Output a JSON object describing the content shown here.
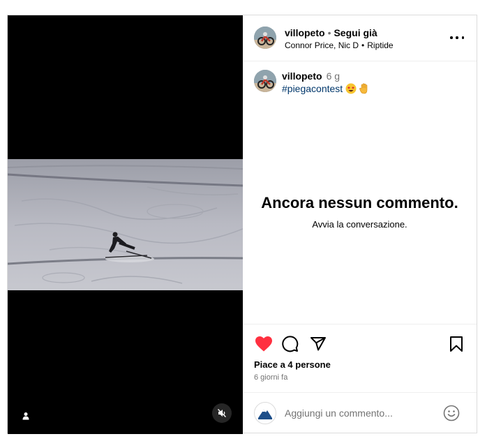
{
  "post": {
    "media": {
      "kind": "video",
      "description": "skier carving on a snowy slope",
      "tag_icon": "person-icon",
      "mute_icon": "muted-speaker-icon"
    },
    "header": {
      "username": "villopeto",
      "separator": "•",
      "follow_label": "Segui già",
      "audio_artists": "Connor Price, Nic D",
      "audio_separator": "•",
      "audio_track": "Riptide",
      "more_icon": "more-horizontal-icon"
    },
    "caption": {
      "username": "villopeto",
      "time": "6 g",
      "hashtag": "#piegacontest",
      "emojis": [
        "star-struck-emoji",
        "raised-hand-emoji"
      ]
    },
    "comments": {
      "empty_title": "Ancora nessun commento.",
      "empty_subtitle": "Avvia la conversazione."
    },
    "actions": {
      "like_icon": "heart-filled-icon",
      "comment_icon": "comment-icon",
      "share_icon": "paper-plane-icon",
      "save_icon": "bookmark-icon",
      "liked": true,
      "like_color": "#ff3040",
      "likes_text": "Piace a 4 persone",
      "date_text": "6 giorni fa"
    },
    "comment_input": {
      "placeholder": "Aggiungi un commento...",
      "avatar_icon": "user-logo-icon",
      "emoji_icon": "smiley-icon"
    }
  }
}
